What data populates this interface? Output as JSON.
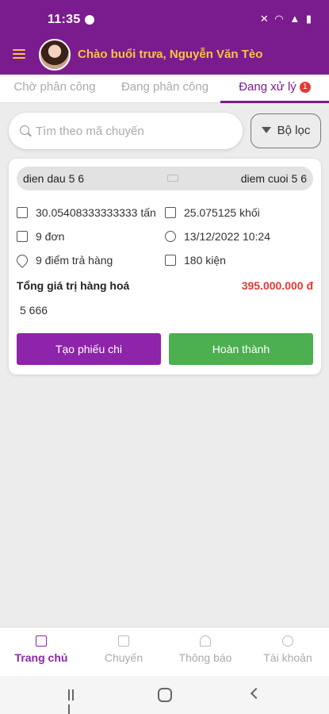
{
  "status_bar": {
    "time": "11:35"
  },
  "header": {
    "greeting": "Chào buổi trưa, Nguyễn Văn Tèo"
  },
  "tabs": [
    {
      "label": "Chờ phân công"
    },
    {
      "label": "Đang phân công"
    },
    {
      "label": "Đang xử lý",
      "badge": "1",
      "active": true
    }
  ],
  "search": {
    "placeholder": "Tìm theo mã chuyến",
    "value": ""
  },
  "filter": {
    "label": "Bộ lọc"
  },
  "trip": {
    "from": "dien dau 5 6",
    "to": "diem cuoi 5 6",
    "weight": "30.05408333333333 tấn",
    "volume": "25.075125 khối",
    "orders": "9 đơn",
    "datetime": "13/12/2022 10:24",
    "dropoffs": "9 điểm trả hàng",
    "packages": "180 kiện",
    "total_label": "Tổng giá trị hàng hoá",
    "total_value": "395.000.000 đ",
    "note": "5 666",
    "btn_create": "Tạo phiếu chi",
    "btn_complete": "Hoàn thành"
  },
  "bottom_nav": [
    {
      "label": "Trang chủ",
      "icon": "home-icon",
      "active": true
    },
    {
      "label": "Chuyến",
      "icon": "trip-icon"
    },
    {
      "label": "Thông báo",
      "icon": "bell-icon"
    },
    {
      "label": "Tài khoản",
      "icon": "user-icon"
    }
  ],
  "colors": {
    "primary": "#7b1c8e",
    "accent": "#f5c542",
    "danger": "#e53935",
    "success": "#4caf50"
  }
}
